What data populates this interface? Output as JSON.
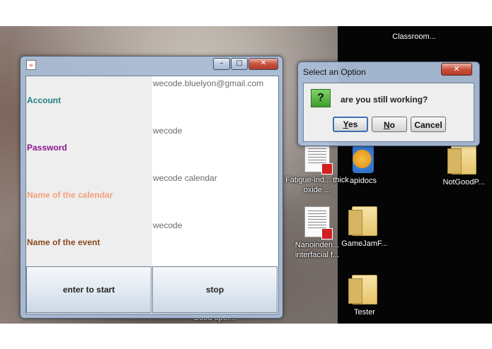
{
  "desktop": {
    "icons": [
      {
        "label": "Classroom..."
      },
      {
        "label": "Fatigue-ind... thick oxide ..."
      },
      {
        "label": "apidocs"
      },
      {
        "label": "NotGoodP..."
      },
      {
        "label": "Nanoinden... interfacial f..."
      },
      {
        "label": "GameJamF..."
      },
      {
        "label": "Tester"
      },
      {
        "label": "Good uper..."
      }
    ]
  },
  "main_window": {
    "icon": "java-icon",
    "minimize_glyph": "–",
    "maximize_glyph": "□",
    "close_glyph": "✕",
    "fields": [
      {
        "label": "Account",
        "value": "wecode.bluelyon@gmail.com",
        "color": "#1f8080"
      },
      {
        "label": "Password",
        "value": "wecode",
        "color": "#8b168b"
      },
      {
        "label": "Name of the calendar",
        "value": "wecode calendar",
        "color": "#f4a07a"
      },
      {
        "label": "Name of the event",
        "value": "wecode",
        "color": "#8a4a1c"
      }
    ],
    "buttons": {
      "start": "enter to start",
      "stop": "stop"
    }
  },
  "dialog": {
    "title": "Select an Option",
    "close_glyph": "✕",
    "question_icon": "?",
    "message": "are you still working?",
    "buttons": {
      "yes": {
        "mnemonic": "Y",
        "rest": "es"
      },
      "no": {
        "mnemonic": "N",
        "rest": "o"
      },
      "cancel": "Cancel"
    }
  }
}
